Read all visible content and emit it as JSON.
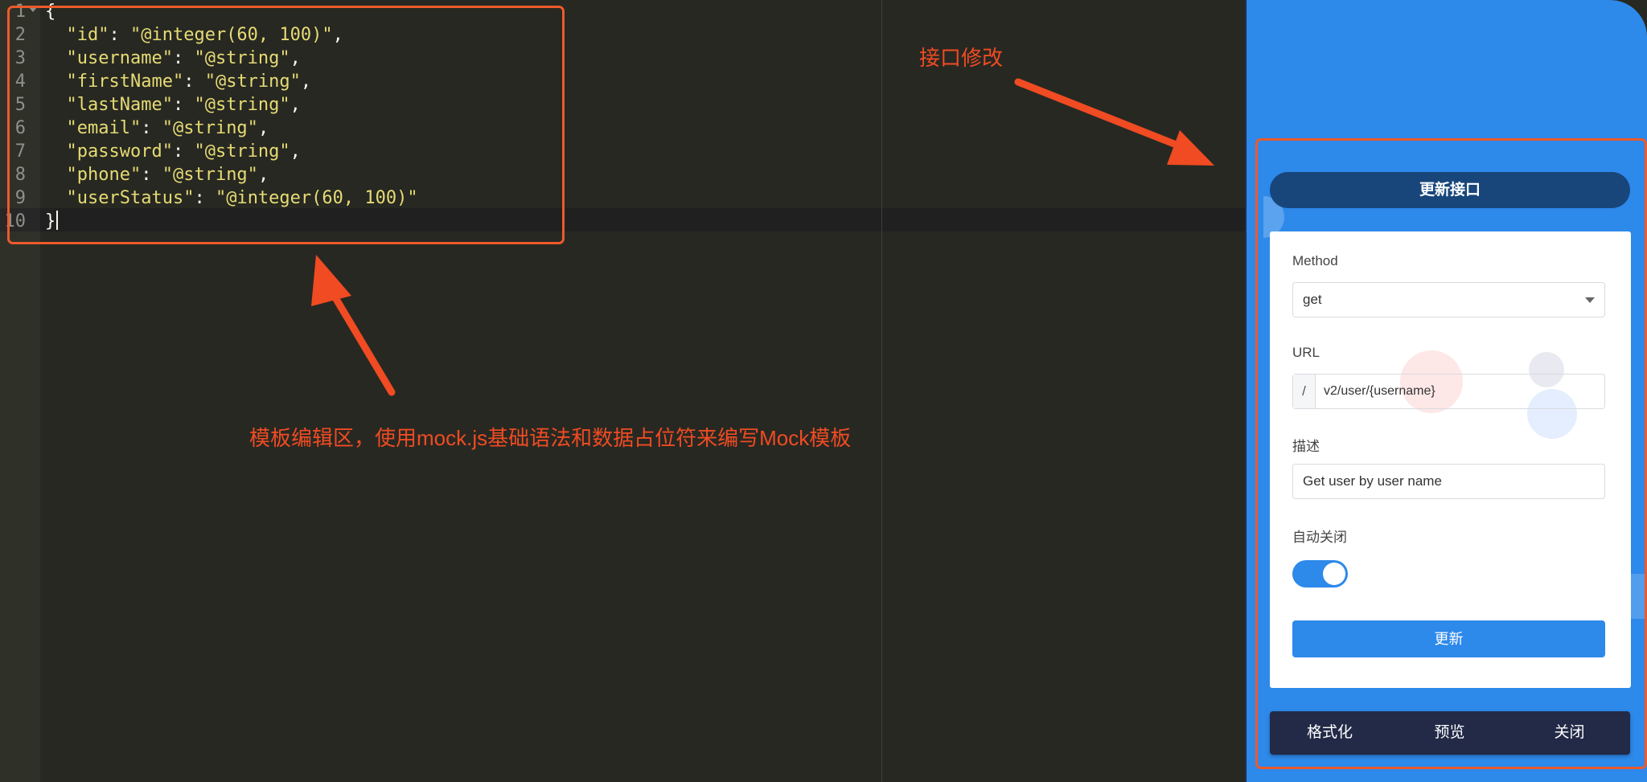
{
  "editor": {
    "line_numbers": [
      "1",
      "2",
      "3",
      "4",
      "5",
      "6",
      "7",
      "8",
      "9",
      "10"
    ],
    "lines": [
      {
        "key": "",
        "value": "",
        "punct": "{"
      },
      {
        "key": "\"id\"",
        "value": "\"@integer(60, 100)\"",
        "punct": ","
      },
      {
        "key": "\"username\"",
        "value": "\"@string\"",
        "punct": ","
      },
      {
        "key": "\"firstName\"",
        "value": "\"@string\"",
        "punct": ","
      },
      {
        "key": "\"lastName\"",
        "value": "\"@string\"",
        "punct": ","
      },
      {
        "key": "\"email\"",
        "value": "\"@string\"",
        "punct": ","
      },
      {
        "key": "\"password\"",
        "value": "\"@string\"",
        "punct": ","
      },
      {
        "key": "\"phone\"",
        "value": "\"@string\"",
        "punct": ","
      },
      {
        "key": "\"userStatus\"",
        "value": "\"@integer(60, 100)\"",
        "punct": ""
      },
      {
        "key": "",
        "value": "",
        "punct": "}"
      }
    ]
  },
  "annotations": {
    "editor_note": "模板编辑区，使用mock.js基础语法和数据占位符来编写Mock模板",
    "panel_note": "接口修改"
  },
  "panel": {
    "title": "更新接口",
    "method_label": "Method",
    "method_value": "get",
    "url_label": "URL",
    "url_prefix": "/",
    "url_value": "v2/user/{username}",
    "desc_label": "描述",
    "desc_value": "Get user by user name",
    "auto_close_label": "自动关闭",
    "auto_close_on": true,
    "update_button": "更新",
    "footer": {
      "format_button": "格式化",
      "preview_button": "预览",
      "close_button": "关闭"
    }
  },
  "colors": {
    "editor_bg": "#272822",
    "string": "#e6db74",
    "annotation": "#ee5a2a",
    "panel_bg": "#2d89ea",
    "title_pill": "#18467a",
    "footer_bar": "#222a47"
  }
}
